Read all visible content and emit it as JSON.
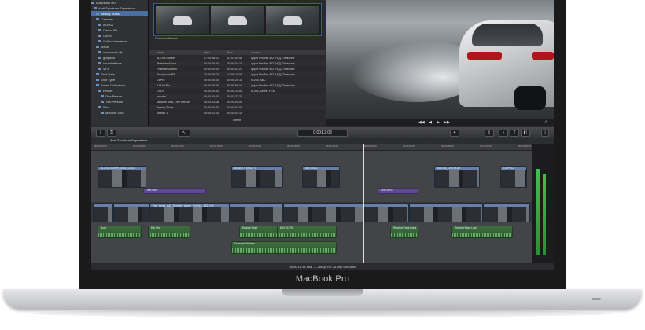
{
  "device": {
    "label": "MacBook Pro"
  },
  "library": {
    "items": [
      {
        "label": "Macintosh HD",
        "selected": false
      },
      {
        "label": "Audi Sportscar Experience",
        "selected": false
      },
      {
        "label": "Beauty Shots",
        "selected": true
      },
      {
        "label": "Cameras",
        "selected": false
      },
      {
        "label": "ALEXA",
        "selected": false
      },
      {
        "label": "Canon 5D",
        "selected": false
      },
      {
        "label": "GoPro",
        "selected": false
      },
      {
        "label": "GoPro interviews",
        "selected": false
      },
      {
        "label": "Media",
        "selected": false
      },
      {
        "label": "composed clip",
        "selected": false
      },
      {
        "label": "graphics",
        "selected": false
      },
      {
        "label": "sound effects",
        "selected": false
      },
      {
        "label": "VFX",
        "selected": false
      },
      {
        "label": "Shot Date",
        "selected": false
      },
      {
        "label": "Shot Type",
        "selected": false
      },
      {
        "label": "Smart Collections",
        "selected": false
      },
      {
        "label": "People",
        "selected": false
      },
      {
        "label": "One Person",
        "selected": false
      },
      {
        "label": "Two Persons",
        "selected": false
      },
      {
        "label": "Shot",
        "selected": false
      },
      {
        "label": "Medium Shot",
        "selected": false
      }
    ]
  },
  "browser": {
    "filmstrip_label": "Phantom Ahead",
    "headers": [
      "Name",
      "Start",
      "End",
      "Codecs"
    ],
    "rows": [
      [
        "ALEXA Sunset",
        "07:00:46:01",
        "07:01:04:55",
        "Apple ProRes 422 (HQ), Timecode"
      ],
      [
        "Phantom Above",
        "00:00:00:00",
        "00:00:04:15",
        "Apple ProRes 422 (HQ), Timecode"
      ],
      [
        "Phantom Ahead",
        "00:00:00:00",
        "00:00:03:22",
        "Apple ProRes 422 (HQ), Timecode"
      ],
      [
        "Steadycam R8",
        "10:00:05:15",
        "10:00:19:08",
        "Apple ProRes 422 (HQ), Timecode"
      ],
      [
        "GoPro",
        "00:00:00:00",
        "00:00:24:16",
        "H.264, AAC"
      ],
      [
        "AJA Ki Pro",
        "00:00:00:00",
        "00:00:58:14",
        "Apple ProRes 422 (HQ), Timecode"
      ],
      [
        "DSLR",
        "00:00:00:00",
        "00:00:10:09",
        "H.264, Linear PCM"
      ],
      [
        "favorite",
        "00:00:00:00",
        "00:01:27:20",
        ""
      ],
      [
        "Medium Shot, One Person",
        "00:00:03:18",
        "00:00:05:05",
        ""
      ],
      [
        "Beauty Shots",
        "00:00:00:00",
        "00:00:07:05",
        ""
      ],
      [
        "Marker 1",
        "00:00:01:10",
        "00:00:01:10",
        ""
      ]
    ],
    "footer": "7 items"
  },
  "viewer": {
    "controls": [
      "◀◀",
      "◀",
      "▶",
      "▶▶",
      "⤢"
    ]
  },
  "toolbar": {
    "timecode": "0:00:12:03",
    "project": "Audi Sportscar Experience"
  },
  "timeline": {
    "ticks": [
      "00:00:00:00",
      "00:00:05:00",
      "00:00:10:00",
      "00:00:15:00",
      "00:00:20:00",
      "00:00:25:00",
      "00:00:30:00",
      "00:00:35:00",
      "00:00:40:00",
      "00:00:45:00",
      "00:00:50:00",
      "00:00:55:00"
    ],
    "connected_clips": [
      {
        "label": "ALEXA Sunset_0001_C001"
      },
      {
        "label": "BEAUTY SHOT 1"
      },
      {
        "label": "MVI_0412"
      },
      {
        "label": "ALEXA_OVERLAY"
      },
      {
        "label": "GOPRO"
      }
    ],
    "titles": [
      {
        "label": "Text Intro"
      },
      {
        "label": "Text Intro"
      }
    ],
    "audio": [
      {
        "label": "Audi"
      },
      {
        "label": "Rip On"
      },
      {
        "label": "Engine Start"
      },
      {
        "label": "MVI_0376"
      },
      {
        "label": "Rewind Pass Long"
      },
      {
        "label": "Rewind Pass Long"
      },
      {
        "label": "Drumbed Rehtm"
      }
    ],
    "storyline_label": "Pan_Lead_AAt_Top/Left_Apple_ProRes_422_HQ",
    "status": "00:00:18:15 total — 1080p HD 23.98p Surround"
  },
  "colors": {
    "selection": "#4a6fa5",
    "title_clip": "#5d4a8e",
    "audio_clip": "#3c6e3e",
    "video_clip": "#6a7fa7"
  }
}
